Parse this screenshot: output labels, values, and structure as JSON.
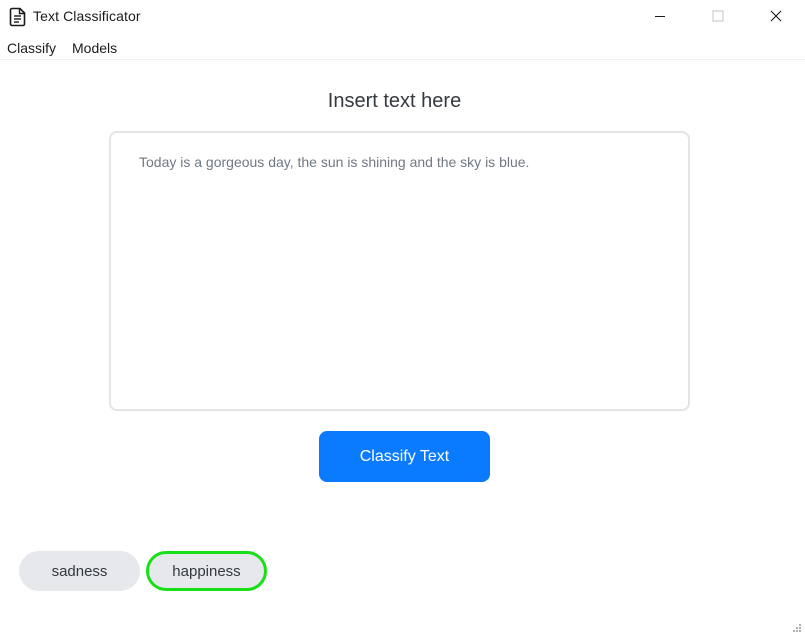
{
  "window": {
    "title": "Text Classificator",
    "icon": "document-icon",
    "controls": [
      "minimize-icon",
      "maximize-icon",
      "close-icon"
    ]
  },
  "menu": {
    "items": [
      {
        "label": "Classify"
      },
      {
        "label": "Models"
      }
    ]
  },
  "main": {
    "heading": "Insert text here",
    "input_text": "Today is a gorgeous day, the sun is shining and the sky is blue.",
    "button_label": "Classify Text"
  },
  "results": {
    "labels": [
      {
        "label": "sadness",
        "selected": false
      },
      {
        "label": "happiness",
        "selected": true
      }
    ]
  },
  "colors": {
    "accent": "#0a7bff",
    "highlight": "#18e018",
    "chip_bg": "#e6e8eb"
  }
}
